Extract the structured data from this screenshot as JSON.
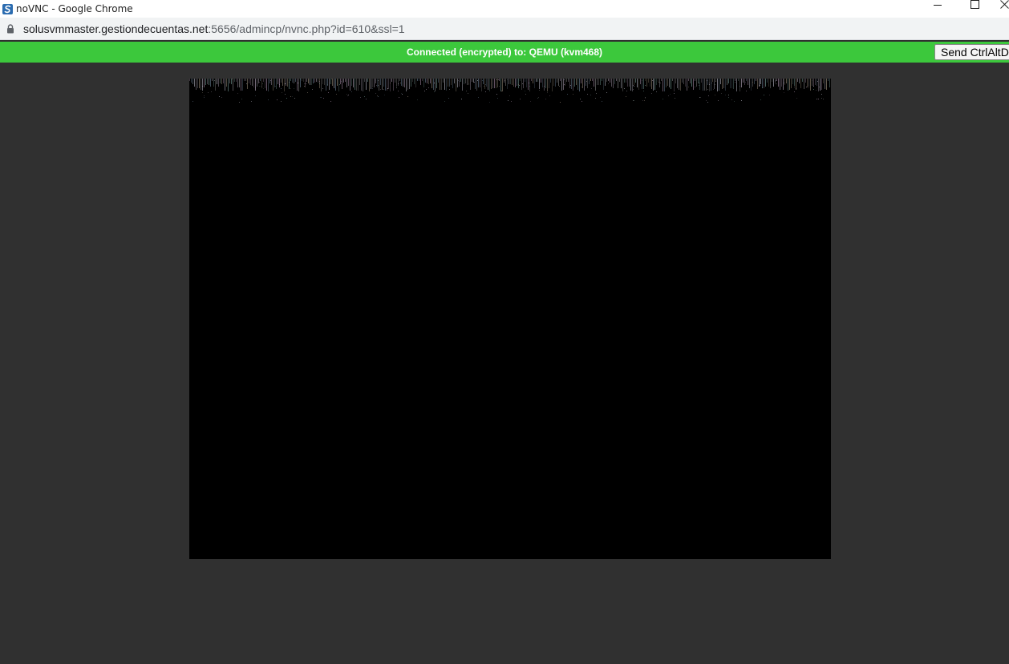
{
  "window": {
    "title": "noVNC - Google Chrome"
  },
  "address_bar": {
    "url_host": "solusvmmaster.gestiondecuentas.net",
    "url_path": ":5656/admincp/nvnc.php?id=610&ssl=1"
  },
  "novnc": {
    "status_text": "Connected (encrypted) to: QEMU (kvm468)",
    "send_ctrl_alt_del_label": "Send CtrlAltDel",
    "status_color": "#3cc83c"
  },
  "icons": {
    "app": "solusvm-logo-icon",
    "minimize": "minimize-icon",
    "maximize": "maximize-icon",
    "close": "close-icon",
    "lock": "lock-icon"
  }
}
